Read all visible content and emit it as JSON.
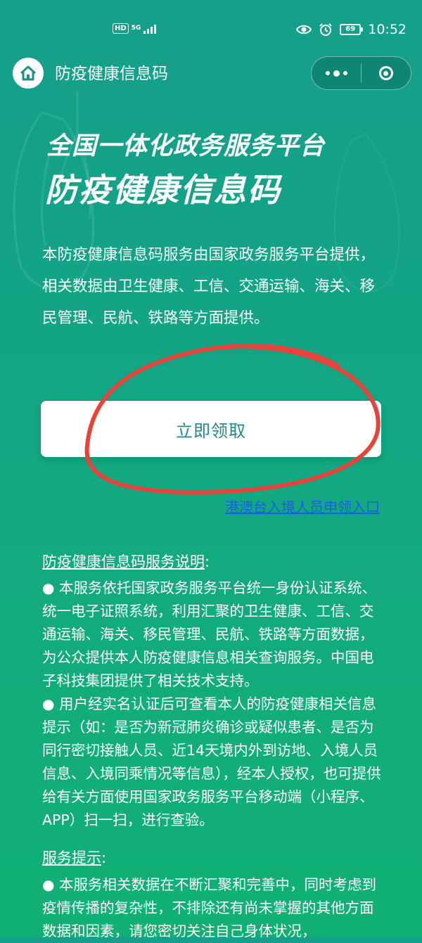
{
  "status_bar": {
    "hd": "HD",
    "network": "5G",
    "battery": "69",
    "time": "10:52"
  },
  "nav": {
    "title": "防疫健康信息码"
  },
  "hero": {
    "headline_line1": "全国一体化政务服务平台",
    "headline_line2": "防疫健康信息码",
    "intro": "本防疫健康信息码服务由国家政务服务平台提供，相关数据由卫生健康、工信、交通运输、海关、移民管理、民航、铁路等方面提供。"
  },
  "claim_button": {
    "label": "立即领取"
  },
  "hk_link": {
    "label": "港澳台入境人员申领入口"
  },
  "service_description": {
    "title": "防疫健康信息码服务说明",
    "colon": ":",
    "paragraphs": [
      "本服务依托国家政务服务平台统一身份认证系统、统一电子证照系统，利用汇聚的卫生健康、工信、交通运输、海关、移民管理、民航、铁路等方面数据，为公众提供本人防疫健康信息相关查询服务。中国电子科技集团提供了相关技术支持。",
      "用户经实名认证后可查看本人的防疫健康相关信息提示（如：是否为新冠肺炎确诊或疑似患者、是否为同行密切接触人员、近14天境内外到访地、入境人员信息、入境同乘情况等信息），经本人授权，也可提供给有关方面使用国家政务服务平台移动端（小程序、APP）扫一扫，进行查验。"
    ]
  },
  "service_tips": {
    "title": "服务提示",
    "colon": ":",
    "paragraphs": [
      "本服务相关数据在不断汇聚和完善中，同时考虑到疫情传播的复杂性，不排除还有尚未掌握的其他方面数据和因素，请您密切关注自己身体状况，"
    ]
  },
  "bullet": "●",
  "colors": {
    "bg_top": "#159f8b",
    "bg_bottom": "#10b075",
    "button_text": "#1f8a8a",
    "link": "#1c5de8",
    "annotation_circle": "#e8433a"
  }
}
